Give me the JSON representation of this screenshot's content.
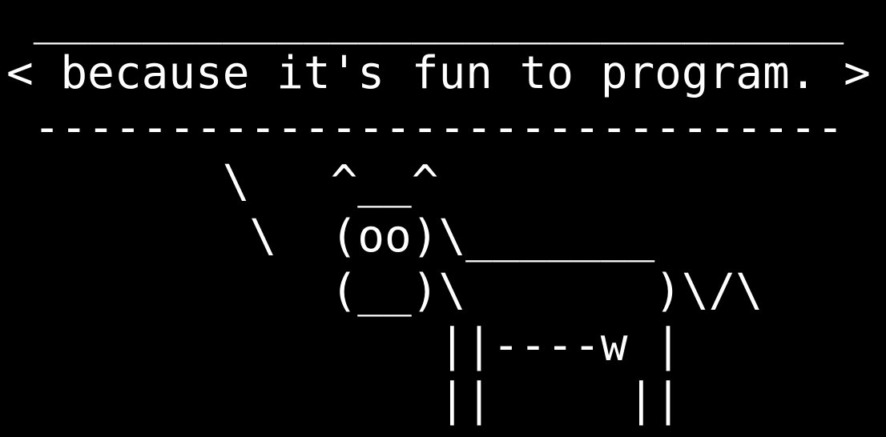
{
  "terminal": {
    "background": "#000000",
    "foreground": "#ffffff",
    "lines": [
      " ______________________________",
      "< because it's fun to program. >",
      " ------------------------------",
      "        \\   ^__^",
      "         \\  (oo)\\_______",
      "            (__)\\       )\\/\\",
      "                ||----w |",
      "                ||     ||"
    ]
  }
}
